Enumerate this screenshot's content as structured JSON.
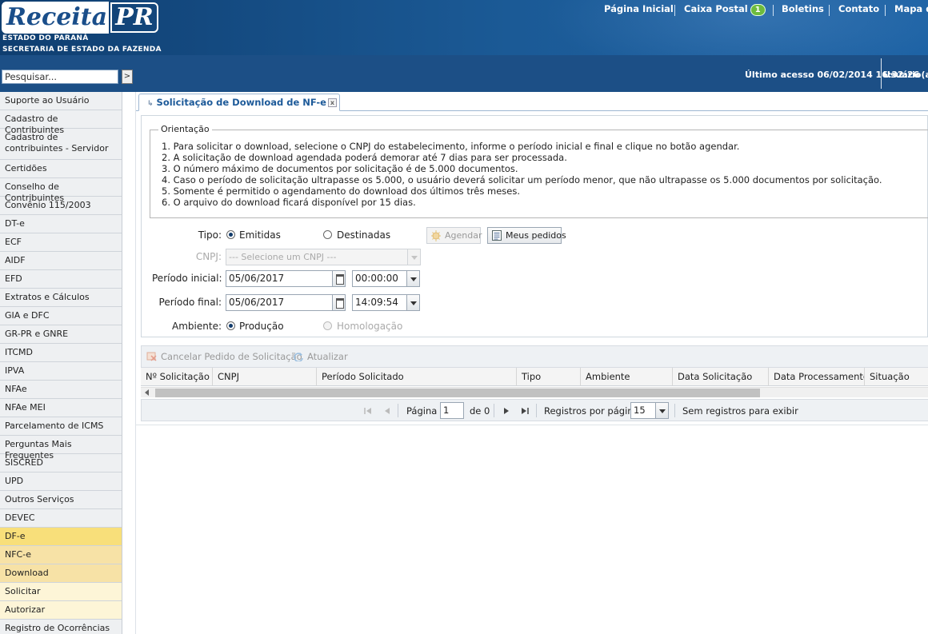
{
  "header": {
    "logo_text": "Receita",
    "logo_suffix": "PR",
    "org_line1": "ESTADO DO PARANÁ",
    "org_line2": "SECRETARIA DE ESTADO DA FAZENDA",
    "nav": {
      "home": "Página Inicial",
      "mailbox": "Caixa Postal",
      "mailbox_count": "1",
      "bulletins": "Boletins",
      "contact": "Contato",
      "sitemap": "Mapa do"
    }
  },
  "topbar": {
    "search_placeholder": "Pesquisar...",
    "search_go": ">",
    "last_access": "Último acesso 06/02/2014 16:32:26",
    "user_label": "Usuário(a) T"
  },
  "sidebar": {
    "items": [
      {
        "label": "Suporte ao Usuário"
      },
      {
        "label": "Cadastro de Contribuintes"
      },
      {
        "label": "Cadastro de contribuintes - Servidor"
      },
      {
        "label": "Certidões"
      },
      {
        "label": "Conselho de Contribuintes"
      },
      {
        "label": "Convênio 115/2003"
      },
      {
        "label": "DT-e"
      },
      {
        "label": "ECF"
      },
      {
        "label": "AIDF"
      },
      {
        "label": "EFD"
      },
      {
        "label": "Extratos e Cálculos"
      },
      {
        "label": "GIA e DFC"
      },
      {
        "label": "GR-PR e GNRE"
      },
      {
        "label": "ITCMD"
      },
      {
        "label": "IPVA"
      },
      {
        "label": "NFAe"
      },
      {
        "label": "NFAe MEI"
      },
      {
        "label": "Parcelamento de ICMS"
      },
      {
        "label": "Perguntas Mais Frequentes"
      },
      {
        "label": "SISCRED"
      },
      {
        "label": "UPD"
      },
      {
        "label": "Outros Serviços"
      },
      {
        "label": "DEVEC"
      },
      {
        "label": "DF-e"
      },
      {
        "label": "NFC-e"
      },
      {
        "label": "Download"
      },
      {
        "label": "Solicitar"
      },
      {
        "label": "Autorizar"
      },
      {
        "label": "Registro de Ocorrências"
      }
    ]
  },
  "tab": {
    "title": "Solicitação de Download de NF-e",
    "icon": "arrow-icon",
    "close": "x"
  },
  "form": {
    "orientation_title": "Orientação",
    "orientation": [
      "1. Para solicitar o download, selecione o CNPJ do estabelecimento, informe o período inicial e final e clique no botão agendar.",
      "2. A solicitação de download agendada poderá demorar até 7 dias para ser processada.",
      "3. O número máximo de documentos por solicitação é de 5.000 documentos.",
      "4. Caso o período de solicitação ultrapasse os 5.000, o usuário deverá solicitar um período menor, que não ultrapasse os 5.000 documentos por solicitação.",
      "5. Somente é permitido o agendamento do download dos últimos três meses.",
      "6. O arquivo do download ficará disponível por 15 dias."
    ],
    "tipo_label": "Tipo:",
    "tipo_emitidas": "Emitidas",
    "tipo_destinadas": "Destinadas",
    "agendar": "Agendar",
    "meus_pedidos": "Meus pedidos",
    "cnpj_label": "CNPJ:",
    "cnpj_placeholder": "--- Selecione um CNPJ ---",
    "inicial_label": "Período inicial:",
    "inicial_date": "05/06/2017",
    "inicial_time": "00:00:00",
    "final_label": "Período final:",
    "final_date": "05/06/2017",
    "final_time": "14:09:54",
    "ambiente_label": "Ambiente:",
    "ambiente_producao": "Produção",
    "ambiente_homologacao": "Homologação"
  },
  "grid": {
    "cancel": "Cancelar Pedido de Solicitação",
    "refresh": "Atualizar",
    "columns": [
      "Nº Solicitação",
      "CNPJ",
      "Período Solicitado",
      "Tipo",
      "Ambiente",
      "Data Solicitação",
      "Data Processamento",
      "Situação"
    ],
    "pager": {
      "page_label": "Página",
      "page_value": "1",
      "of": "de 0",
      "per_page_label": "Registros por página",
      "per_page_value": "15",
      "empty": "Sem registros para exibir"
    }
  },
  "colors": {
    "header_blue": "#1c4f86",
    "tab_title": "#1d5a99",
    "selected_df": "#f8df7a",
    "selected_nfce": "#f7e2a6",
    "submenu": "#fdf5d7"
  }
}
